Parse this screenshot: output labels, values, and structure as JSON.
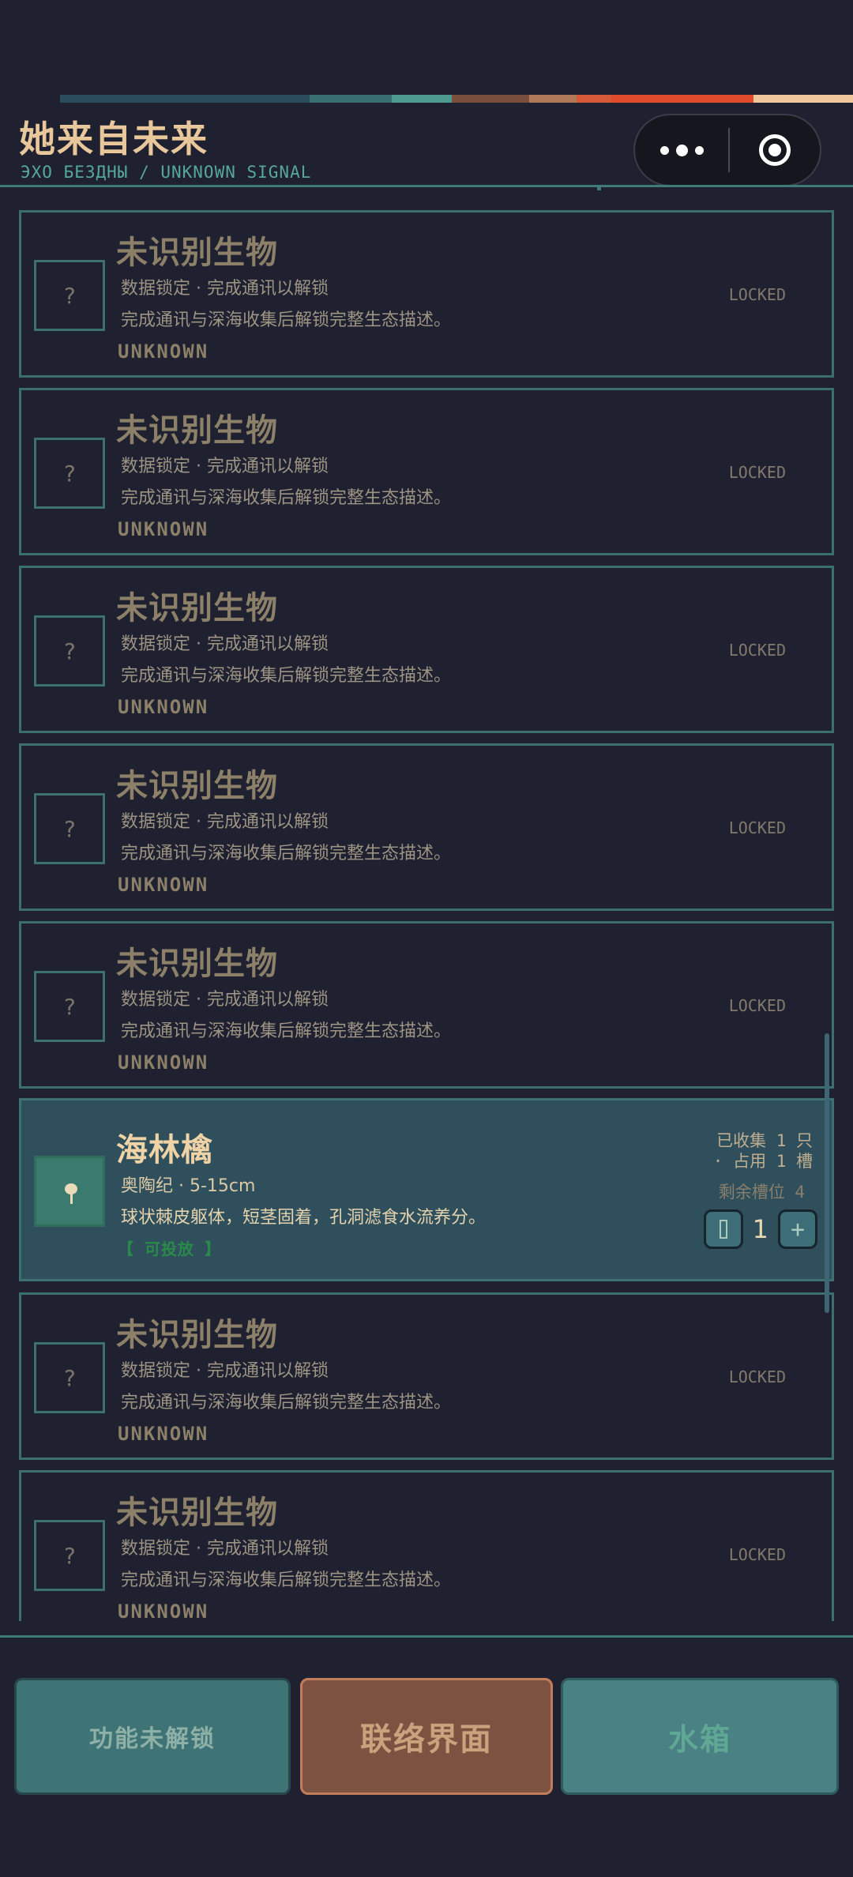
{
  "header": {
    "title": "她来自未来",
    "subtitle": "ЭХО БЕЗДНЫ / UNKNOWN SIGNAL",
    "strip_colors": [
      "#2b4c5a",
      "#3a6f72",
      "#4f9a8e",
      "#7a4e3c",
      "#b07a58",
      "#d65a3a",
      "#e04b2c",
      "#f0c79a"
    ]
  },
  "capsule": {
    "more_icon": "more-dots-icon",
    "close_icon": "target-circle-icon"
  },
  "locked_card": {
    "name": "未识别生物",
    "meta": "数据锁定  ·  完成通讯以解锁",
    "desc": "完成通讯与深海收集后解锁完整生态描述。",
    "tag": "UNKNOWN",
    "status": "LOCKED",
    "thumb_glyph": "?"
  },
  "featured": {
    "name": "海林檎",
    "meta": "奥陶纪  ·  5-15cm",
    "desc": "球状棘皮躯体，短茎固着，孔洞滤食水流养分。",
    "tag": "【 可投放 】",
    "owned_line1": "已收集 1 只",
    "owned_line2": "· 占用 1 槽",
    "remain": "剩余槽位 4",
    "quantity": "1",
    "plus": "+"
  },
  "bottom": {
    "left_label": "功能未解锁",
    "center_label": "联络界面",
    "right_label": "水箱"
  }
}
